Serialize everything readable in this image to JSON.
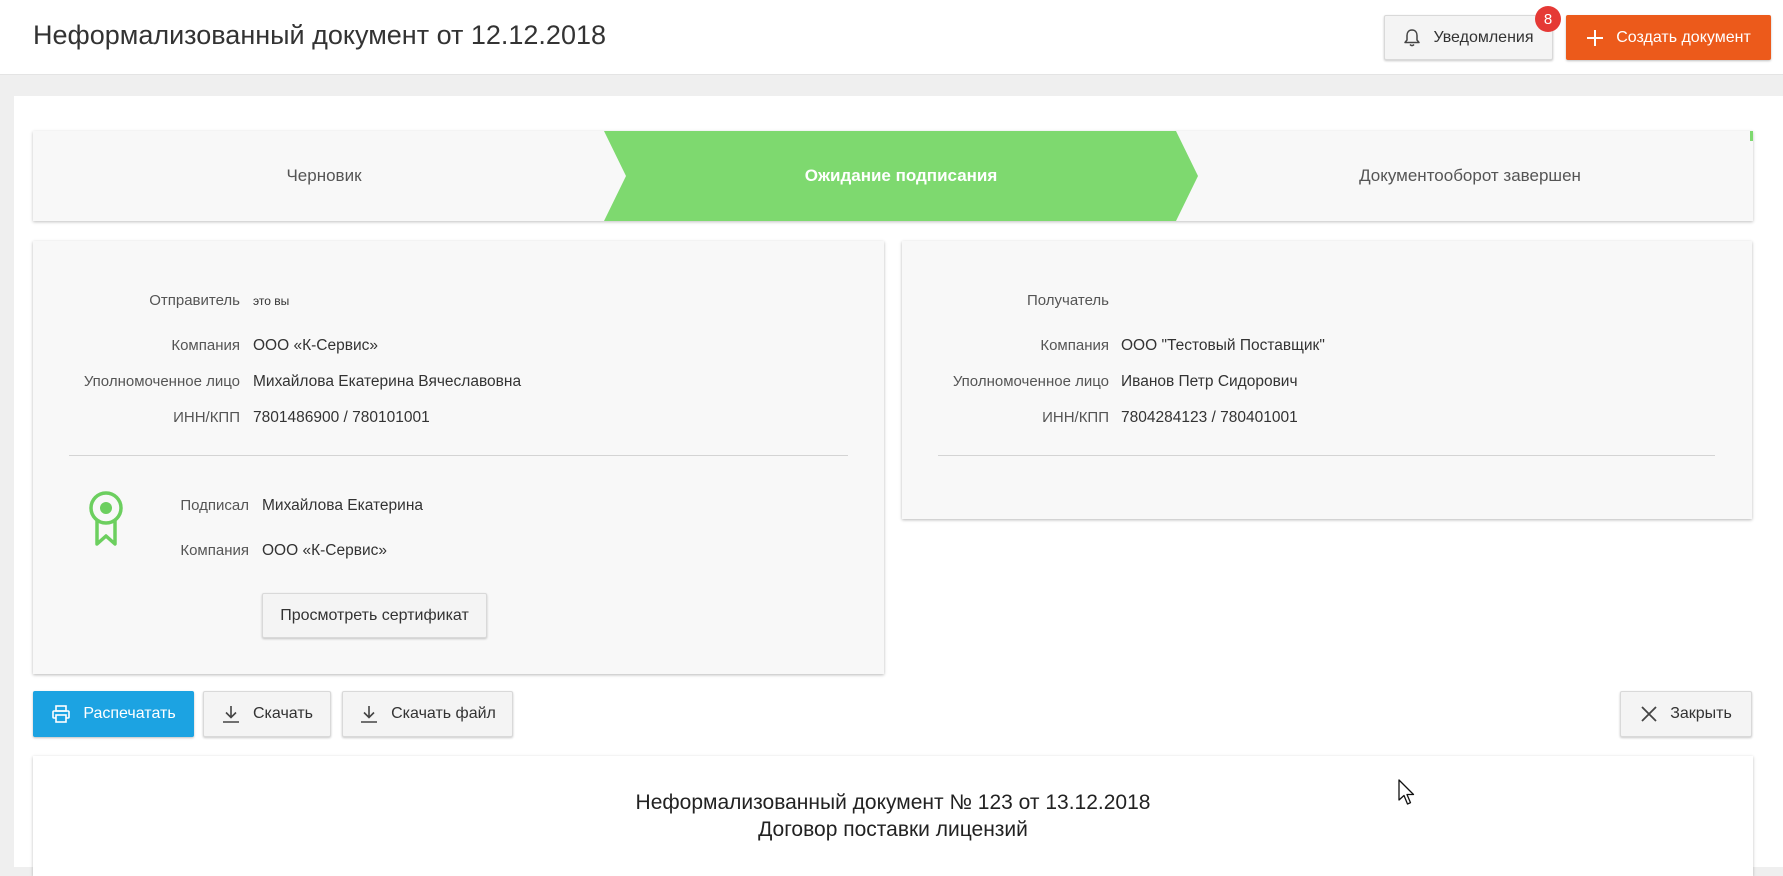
{
  "header": {
    "title": "Неформализованный документ от 12.12.2018",
    "notifications_label": "Уведомления",
    "notifications_count": "8",
    "create_label": "Создать документ"
  },
  "stepper": {
    "steps": [
      {
        "label": "Черновик",
        "active": false
      },
      {
        "label": "Ожидание подписания",
        "active": true
      },
      {
        "label": "Документооборот завершен",
        "active": false
      }
    ],
    "active_color": "#7ed96f"
  },
  "sender": {
    "title_label": "Отправитель",
    "title_value": "это вы",
    "company_label": "Компания",
    "company_value": "ООО «К-Сервис»",
    "person_label": "Уполномоченное лицо",
    "person_value": "Михайлова Екатерина Вячеславовна",
    "inn_label": "ИНН/КПП",
    "inn_value": "7801486900 / 780101001",
    "signed_label": "Подписал",
    "signed_value": "Михайлова Екатерина",
    "signed_company_label": "Компания",
    "signed_company_value": "ООО «К-Сервис»",
    "cert_button": "Просмотреть сертификат",
    "signature_icon": "certificate-ribbon-icon"
  },
  "receiver": {
    "title_label": "Получатель",
    "company_label": "Компания",
    "company_value": "ООО \"Тестовый Поставщик\"",
    "person_label": "Уполномоченное лицо",
    "person_value": "Иванов Петр Сидорович",
    "inn_label": "ИНН/КПП",
    "inn_value": "7804284123 / 780401001"
  },
  "actions": {
    "print": "Распечатать",
    "download": "Скачать",
    "download_file": "Скачать файл",
    "close": "Закрыть"
  },
  "document": {
    "title_line1": "Неформализованный документ № 123 от 13.12.2018",
    "title_line2": "Договор поставки лицензий"
  },
  "colors": {
    "primary_orange": "#ec5a1b",
    "print_blue": "#1ca3e2",
    "badge_red": "#e53935",
    "success_green": "#7ed96f"
  }
}
